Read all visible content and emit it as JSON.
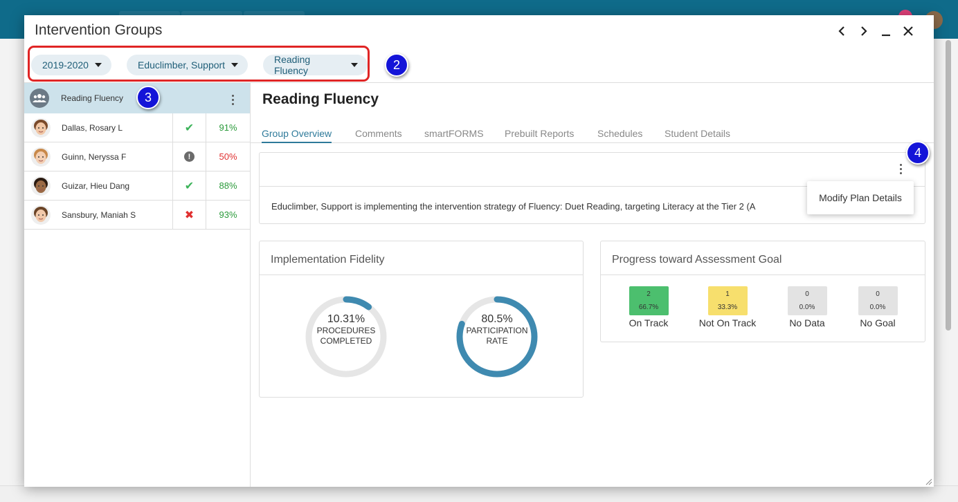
{
  "window": {
    "title": "Intervention Groups",
    "controls": {
      "prev": "‹",
      "next": "›",
      "minimize": "_",
      "close": "✕"
    }
  },
  "filters": [
    {
      "label": "2019-2020"
    },
    {
      "label": "Educlimber, Support"
    },
    {
      "label": "Reading Fluency"
    }
  ],
  "badges": {
    "filters": "2",
    "group": "3",
    "menu": "4"
  },
  "group": {
    "name": "Reading Fluency",
    "icon": "users-group-icon",
    "students": [
      {
        "name": "Dallas, Rosary L",
        "status_icon": "check-icon",
        "status_glyph": "✔",
        "status_color": "#3cb35a",
        "percent": "91%",
        "percent_color": "#2a9a3a",
        "skin": "#f1c7a6",
        "hair": "#7a4a2a"
      },
      {
        "name": "Guinn, Neryssa F",
        "status_icon": "alert-circle-icon",
        "status_glyph": "!",
        "status_color": "#6b6b6b",
        "percent": "50%",
        "percent_color": "#e03030",
        "skin": "#f3cfb3",
        "hair": "#c8894a"
      },
      {
        "name": "Guizar, Hieu Dang",
        "status_icon": "check-icon",
        "status_glyph": "✔",
        "status_color": "#3cb35a",
        "percent": "88%",
        "percent_color": "#2a9a3a",
        "skin": "#9a6a45",
        "hair": "#2a1a10"
      },
      {
        "name": "Sansbury, Maniah S",
        "status_icon": "x-icon",
        "status_glyph": "✖",
        "status_color": "#e03030",
        "percent": "93%",
        "percent_color": "#2a9a3a",
        "skin": "#f1c9ab",
        "hair": "#6a4326"
      }
    ]
  },
  "main": {
    "title": "Reading Fluency",
    "tabs": [
      {
        "label": "Group Overview",
        "active": true
      },
      {
        "label": "Comments"
      },
      {
        "label": "smartFORMS"
      },
      {
        "label": "Prebuilt Reports"
      },
      {
        "label": "Schedules"
      },
      {
        "label": "Student Details"
      }
    ],
    "strategy_text": "Educlimber, Support is implementing the intervention strategy of Fluency: Duet Reading, targeting Literacy at the Tier 2 (A",
    "menu_item": "Modify Plan Details"
  },
  "fidelity": {
    "title": "Implementation Fidelity",
    "ring_color": "#3f8ab0",
    "track_color": "#e6e6e6",
    "procedures": {
      "value": 10.31,
      "pct_label": "10.31%",
      "caption_1": "PROCEDURES",
      "caption_2": "COMPLETED"
    },
    "participation": {
      "value": 80.5,
      "pct_label": "80.5%",
      "caption_1": "PARTICIPATION",
      "caption_2": "RATE"
    }
  },
  "progress": {
    "title": "Progress toward Assessment Goal",
    "items": [
      {
        "count": "2",
        "percent": "66.7%",
        "label": "On Track",
        "color": "#4cbf6e"
      },
      {
        "count": "1",
        "percent": "33.3%",
        "label": "Not On Track",
        "color": "#f7df6d"
      },
      {
        "count": "0",
        "percent": "0.0%",
        "label": "No Data",
        "color": "#e3e3e3"
      },
      {
        "count": "0",
        "percent": "0.0%",
        "label": "No Goal",
        "color": "#e3e3e3"
      }
    ]
  }
}
